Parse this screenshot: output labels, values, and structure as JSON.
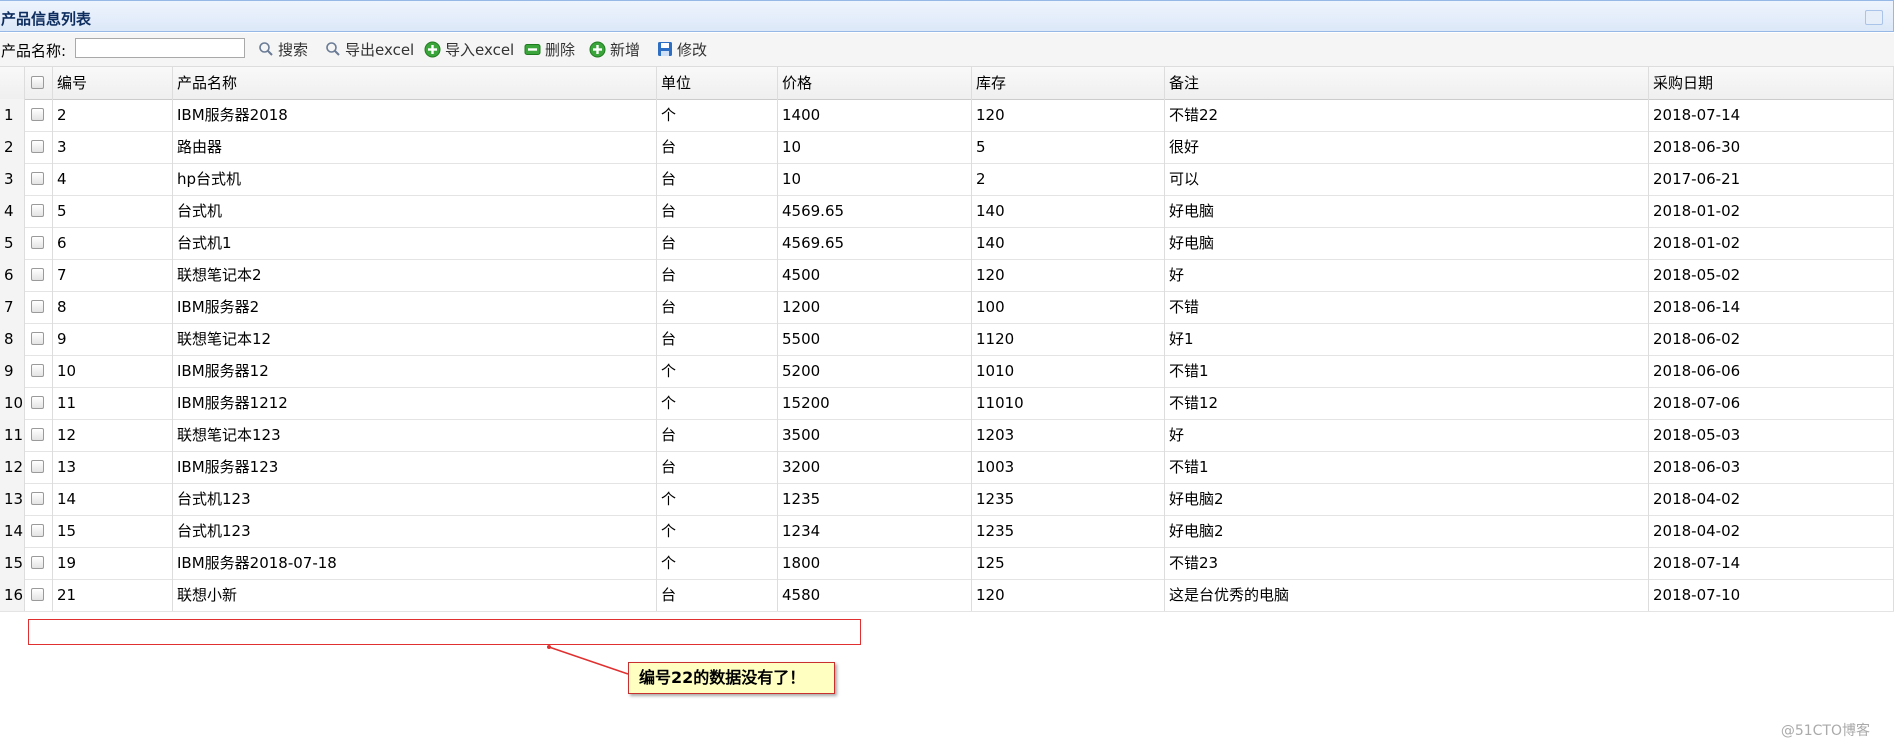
{
  "panel": {
    "title": "产品信息列表"
  },
  "toolbar": {
    "search_label": "产品名称:",
    "search_value": "",
    "buttons": {
      "search": "搜索",
      "export": "导出excel",
      "import": "导入excel",
      "delete": "删除",
      "add": "新增",
      "edit": "修改"
    }
  },
  "table": {
    "headers": [
      "编号",
      "产品名称",
      "单位",
      "价格",
      "库存",
      "备注",
      "采购日期"
    ],
    "rows": [
      {
        "n": "1",
        "id": "2",
        "name": "IBM服务器2018",
        "unit": "个",
        "price": "1400",
        "stock": "120",
        "note": "不错22",
        "date": "2018-07-14"
      },
      {
        "n": "2",
        "id": "3",
        "name": "路由器",
        "unit": "台",
        "price": "10",
        "stock": "5",
        "note": "很好",
        "date": "2018-06-30"
      },
      {
        "n": "3",
        "id": "4",
        "name": "hp台式机",
        "unit": "台",
        "price": "10",
        "stock": "2",
        "note": "可以",
        "date": "2017-06-21"
      },
      {
        "n": "4",
        "id": "5",
        "name": "台式机",
        "unit": "台",
        "price": "4569.65",
        "stock": "140",
        "note": "好电脑",
        "date": "2018-01-02"
      },
      {
        "n": "5",
        "id": "6",
        "name": "台式机1",
        "unit": "台",
        "price": "4569.65",
        "stock": "140",
        "note": "好电脑",
        "date": "2018-01-02"
      },
      {
        "n": "6",
        "id": "7",
        "name": "联想笔记本2",
        "unit": "台",
        "price": "4500",
        "stock": "120",
        "note": "好",
        "date": "2018-05-02"
      },
      {
        "n": "7",
        "id": "8",
        "name": "IBM服务器2",
        "unit": "台",
        "price": "1200",
        "stock": "100",
        "note": "不错",
        "date": "2018-06-14"
      },
      {
        "n": "8",
        "id": "9",
        "name": "联想笔记本12",
        "unit": "台",
        "price": "5500",
        "stock": "1120",
        "note": "好1",
        "date": "2018-06-02"
      },
      {
        "n": "9",
        "id": "10",
        "name": "IBM服务器12",
        "unit": "个",
        "price": "5200",
        "stock": "1010",
        "note": "不错1",
        "date": "2018-06-06"
      },
      {
        "n": "10",
        "id": "11",
        "name": "IBM服务器1212",
        "unit": "个",
        "price": "15200",
        "stock": "11010",
        "note": "不错12",
        "date": "2018-07-06"
      },
      {
        "n": "11",
        "id": "12",
        "name": "联想笔记本123",
        "unit": "台",
        "price": "3500",
        "stock": "1203",
        "note": "好",
        "date": "2018-05-03"
      },
      {
        "n": "12",
        "id": "13",
        "name": "IBM服务器123",
        "unit": "台",
        "price": "3200",
        "stock": "1003",
        "note": "不错1",
        "date": "2018-06-03"
      },
      {
        "n": "13",
        "id": "14",
        "name": "台式机123",
        "unit": "个",
        "price": "1235",
        "stock": "1235",
        "note": "好电脑2",
        "date": "2018-04-02"
      },
      {
        "n": "14",
        "id": "15",
        "name": "台式机123",
        "unit": "个",
        "price": "1234",
        "stock": "1235",
        "note": "好电脑2",
        "date": "2018-04-02"
      },
      {
        "n": "15",
        "id": "19",
        "name": "IBM服务器2018-07-18",
        "unit": "个",
        "price": "1800",
        "stock": "125",
        "note": "不错23",
        "date": "2018-07-14"
      },
      {
        "n": "16",
        "id": "21",
        "name": "联想小新",
        "unit": "台",
        "price": "4580",
        "stock": "120",
        "note": "这是台优秀的电脑",
        "date": "2018-07-10"
      }
    ]
  },
  "annotation": {
    "callout": "编号22的数据没有了！"
  },
  "watermark": "@51CTO博客",
  "colors": {
    "header_border": "#95b8e7",
    "annotation_red": "#e03030",
    "callout_bg": "#ffffc2"
  }
}
